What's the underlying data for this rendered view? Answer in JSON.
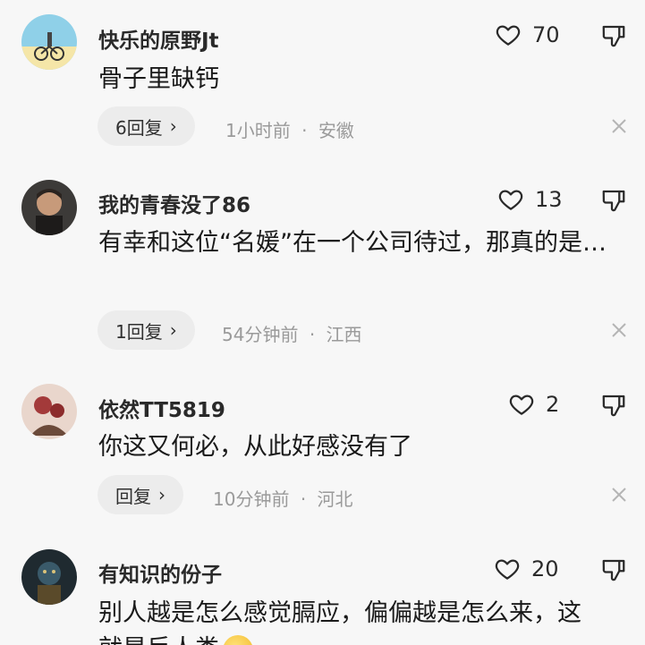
{
  "comments": [
    {
      "username": "快乐的原野Jt",
      "likes": "70",
      "text": "骨子里缺钙",
      "replies": "6回复",
      "time": "1小时前",
      "sep": "·",
      "location": "安徽",
      "avatar_icon": "bicycle-beach-avatar"
    },
    {
      "username": "我的青春没了86",
      "likes": "13",
      "text": "有幸和这位“名媛”在一个公司待过，那真的是…",
      "replies": "1回复",
      "time": "54分钟前",
      "sep": "·",
      "location": "江西",
      "avatar_icon": "man-portrait-avatar"
    },
    {
      "username": "依然TT5819",
      "likes": "2",
      "text": "你这又何必，从此好感没有了",
      "replies": "回复",
      "time": "10分钟前",
      "sep": "·",
      "location": "河北",
      "avatar_icon": "flower-avatar"
    },
    {
      "username": "有知识的份子",
      "likes": "20",
      "text": "别人越是怎么感觉膈应，偏偏越是怎么来，这",
      "text_line2": "就是反人类",
      "avatar_icon": "statue-avatar"
    }
  ],
  "colors": {
    "background": "#f7f7f7",
    "meta_text": "#9a9a9a",
    "pill_bg": "#ececec"
  }
}
